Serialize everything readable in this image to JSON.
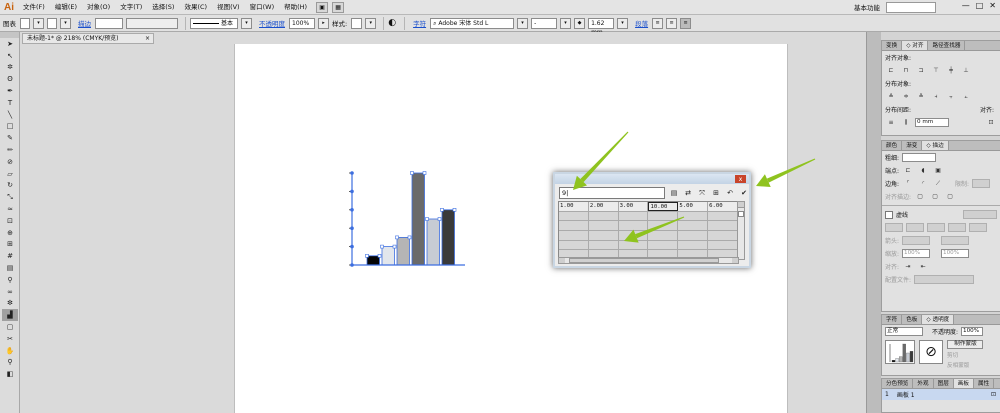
{
  "app": {
    "logo": "Ai",
    "workspace": "基本功能",
    "window_controls": [
      "—",
      "□",
      "✕"
    ]
  },
  "menu": [
    "文件(F)",
    "编辑(E)",
    "对象(O)",
    "文字(T)",
    "选择(S)",
    "效果(C)",
    "视图(V)",
    "窗口(W)",
    "帮助(H)"
  ],
  "control_bar": {
    "selection": "图表",
    "stroke_link": "描边",
    "stroke_style_label": "基本",
    "opacity_link": "不透明度",
    "opacity_value": "100%",
    "style_label": "样式:",
    "char_link": "字符",
    "font_name": "Adobe 宋体 Std L",
    "font_style": "-",
    "font_size": "1.62 mm",
    "para_link": "段落"
  },
  "document": {
    "tab": "未标题-1* @ 218% (CMYK/预览)",
    "tab_close": "×"
  },
  "chart_data": {
    "type": "bar",
    "values": [
      1,
      2,
      3,
      10,
      5,
      6
    ],
    "ylim": [
      0,
      10
    ],
    "colors": [
      "#050505",
      "#e2e6ec",
      "#b5b5b5",
      "#6a6a6a",
      "#c7ccd4",
      "#3a3a3a"
    ],
    "selection_color": "#3c6ee0"
  },
  "graph_data_window": {
    "input_value": "9|",
    "rows": [
      [
        "1.00",
        "2.00",
        "3.00",
        "10.00",
        "5.00",
        "6.00"
      ],
      [
        "",
        "",
        "",
        "",
        "",
        ""
      ],
      [
        "",
        "",
        "",
        "",
        "",
        ""
      ],
      [
        "",
        "",
        "",
        "",
        "",
        ""
      ],
      [
        "",
        "",
        "",
        "",
        "",
        ""
      ],
      [
        "",
        "",
        "",
        "",
        "",
        ""
      ]
    ],
    "close": "x",
    "icons": [
      "import-data-icon",
      "transpose-icon",
      "switch-xy-icon",
      "cell-style-icon",
      "revert-icon",
      "apply-icon"
    ]
  },
  "annotations": {
    "arrow_color": "#8fc31f"
  },
  "panels": {
    "align": {
      "tabs": [
        "变换",
        "◇ 对齐",
        "路径查找器"
      ],
      "align_objects": "对齐对象:",
      "distribute_objects": "分布对象:",
      "distribute_spacing": "分布间距:",
      "spacing_value": "0 mm",
      "align_to": "对齐:"
    },
    "stroke": {
      "tabs": [
        "颜色",
        "渐变",
        "◇ 描边"
      ],
      "weight": "粗细:",
      "cap": "端点:",
      "corner": "边角:",
      "limit": "限制:",
      "align_stroke": "对齐描边:",
      "dashed": "虚线",
      "arrow_label": "箭头:",
      "scale_label": "缩放:",
      "scale_value": "100%",
      "align_label": "对齐:",
      "profile_label": "配置文件:"
    },
    "transparency": {
      "tabs": [
        "字符",
        "色板",
        "◇ 透明度"
      ],
      "mode": "正常",
      "opacity_label": "不透明度:",
      "opacity_value": "100%",
      "make_mask": "制作蒙版",
      "clip": "剪切",
      "invert": "反相蒙版"
    },
    "artboards": {
      "tabs": [
        "分色预览",
        "外观",
        "图层",
        "画板",
        "属性"
      ],
      "row_index": "1",
      "row_name": "画板 1"
    }
  }
}
